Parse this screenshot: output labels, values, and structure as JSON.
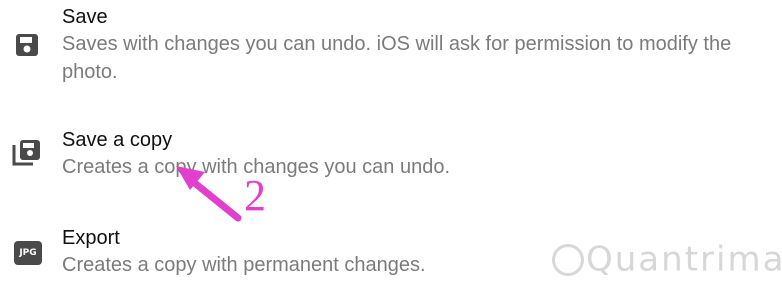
{
  "menu": {
    "items": [
      {
        "icon": "save-floppy-icon",
        "title": "Save",
        "description": "Saves with changes you can undo. iOS will ask for permission to modify the photo."
      },
      {
        "icon": "save-copy-icon",
        "title": "Save a copy",
        "description": "Creates a copy with changes you can undo."
      },
      {
        "icon": "jpg-icon",
        "badge": "JPG",
        "title": "Export",
        "description": "Creates a copy with permanent changes."
      }
    ]
  },
  "annotation": {
    "step_number": "2",
    "color": "#e23fcf"
  },
  "watermark": {
    "text": "Quantrimang"
  }
}
